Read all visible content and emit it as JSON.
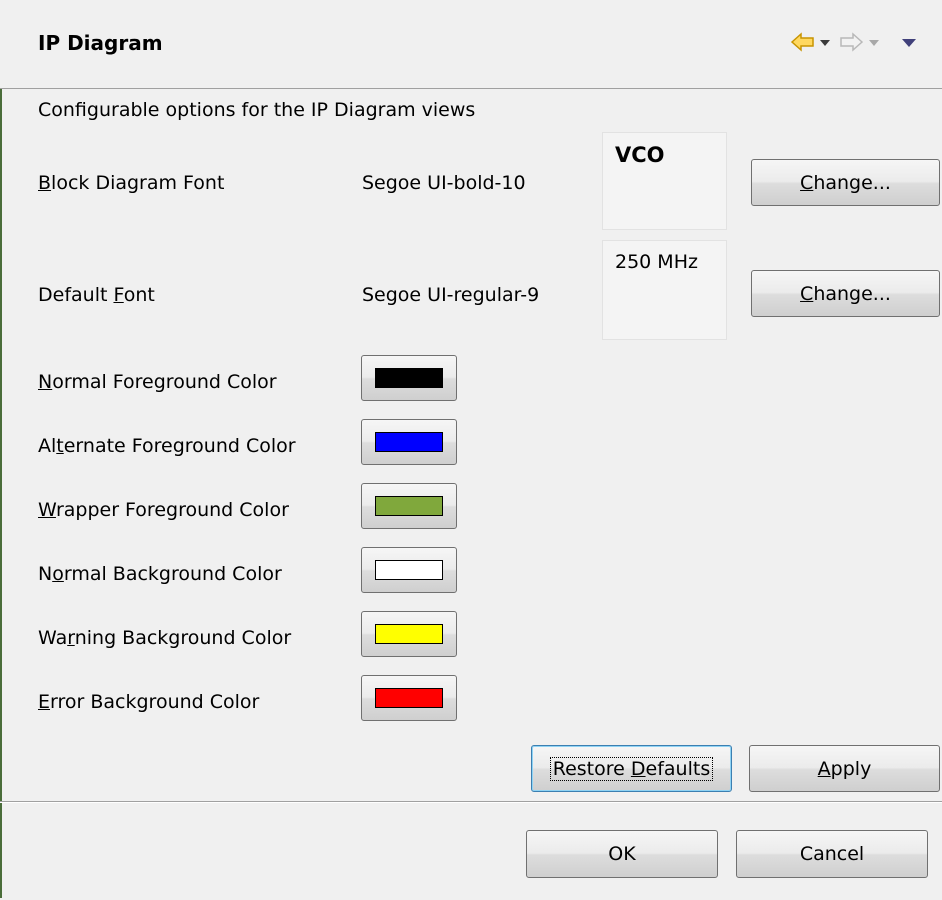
{
  "header": {
    "title": "IP Diagram",
    "back_icon": "arrow-left-icon",
    "back_menu_icon": "dropdown-icon",
    "forward_icon": "arrow-right-icon",
    "forward_menu_icon": "dropdown-icon",
    "view_menu_icon": "view-menu-icon"
  },
  "description": "Configurable options for the IP Diagram views",
  "fonts": [
    {
      "label_mnemonic": "B",
      "label_rest": "lock Diagram Font",
      "value": "Segoe UI-bold-10",
      "preview": "VCO",
      "change_mnemonic": "C",
      "change_rest": "hange..."
    },
    {
      "label_pre": "Default ",
      "label_mnemonic": "F",
      "label_rest": "ont",
      "value": "Segoe UI-regular-9",
      "preview": "250 MHz",
      "change_mnemonic": "C",
      "change_rest": "hange..."
    }
  ],
  "colors": [
    {
      "pre": "",
      "mnemonic": "N",
      "rest": "ormal Foreground Color",
      "swatch": "#000000"
    },
    {
      "pre": "Al",
      "mnemonic": "t",
      "rest": "ernate Foreground Color",
      "swatch": "#0000ff"
    },
    {
      "pre": "",
      "mnemonic": "W",
      "rest": "rapper Foreground Color",
      "swatch": "#80a83c"
    },
    {
      "pre": "N",
      "mnemonic": "o",
      "rest": "rmal Background Color",
      "swatch": "#ffffff"
    },
    {
      "pre": "Wa",
      "mnemonic": "r",
      "rest": "ning Background Color",
      "swatch": "#ffff00"
    },
    {
      "pre": "",
      "mnemonic": "E",
      "rest": "rror Background Color",
      "swatch": "#ff0000"
    }
  ],
  "buttons": {
    "restore_pre": "Restore ",
    "restore_mnemonic": "D",
    "restore_rest": "efaults",
    "apply_mnemonic": "A",
    "apply_rest": "pply",
    "ok": "OK",
    "cancel": "Cancel"
  }
}
